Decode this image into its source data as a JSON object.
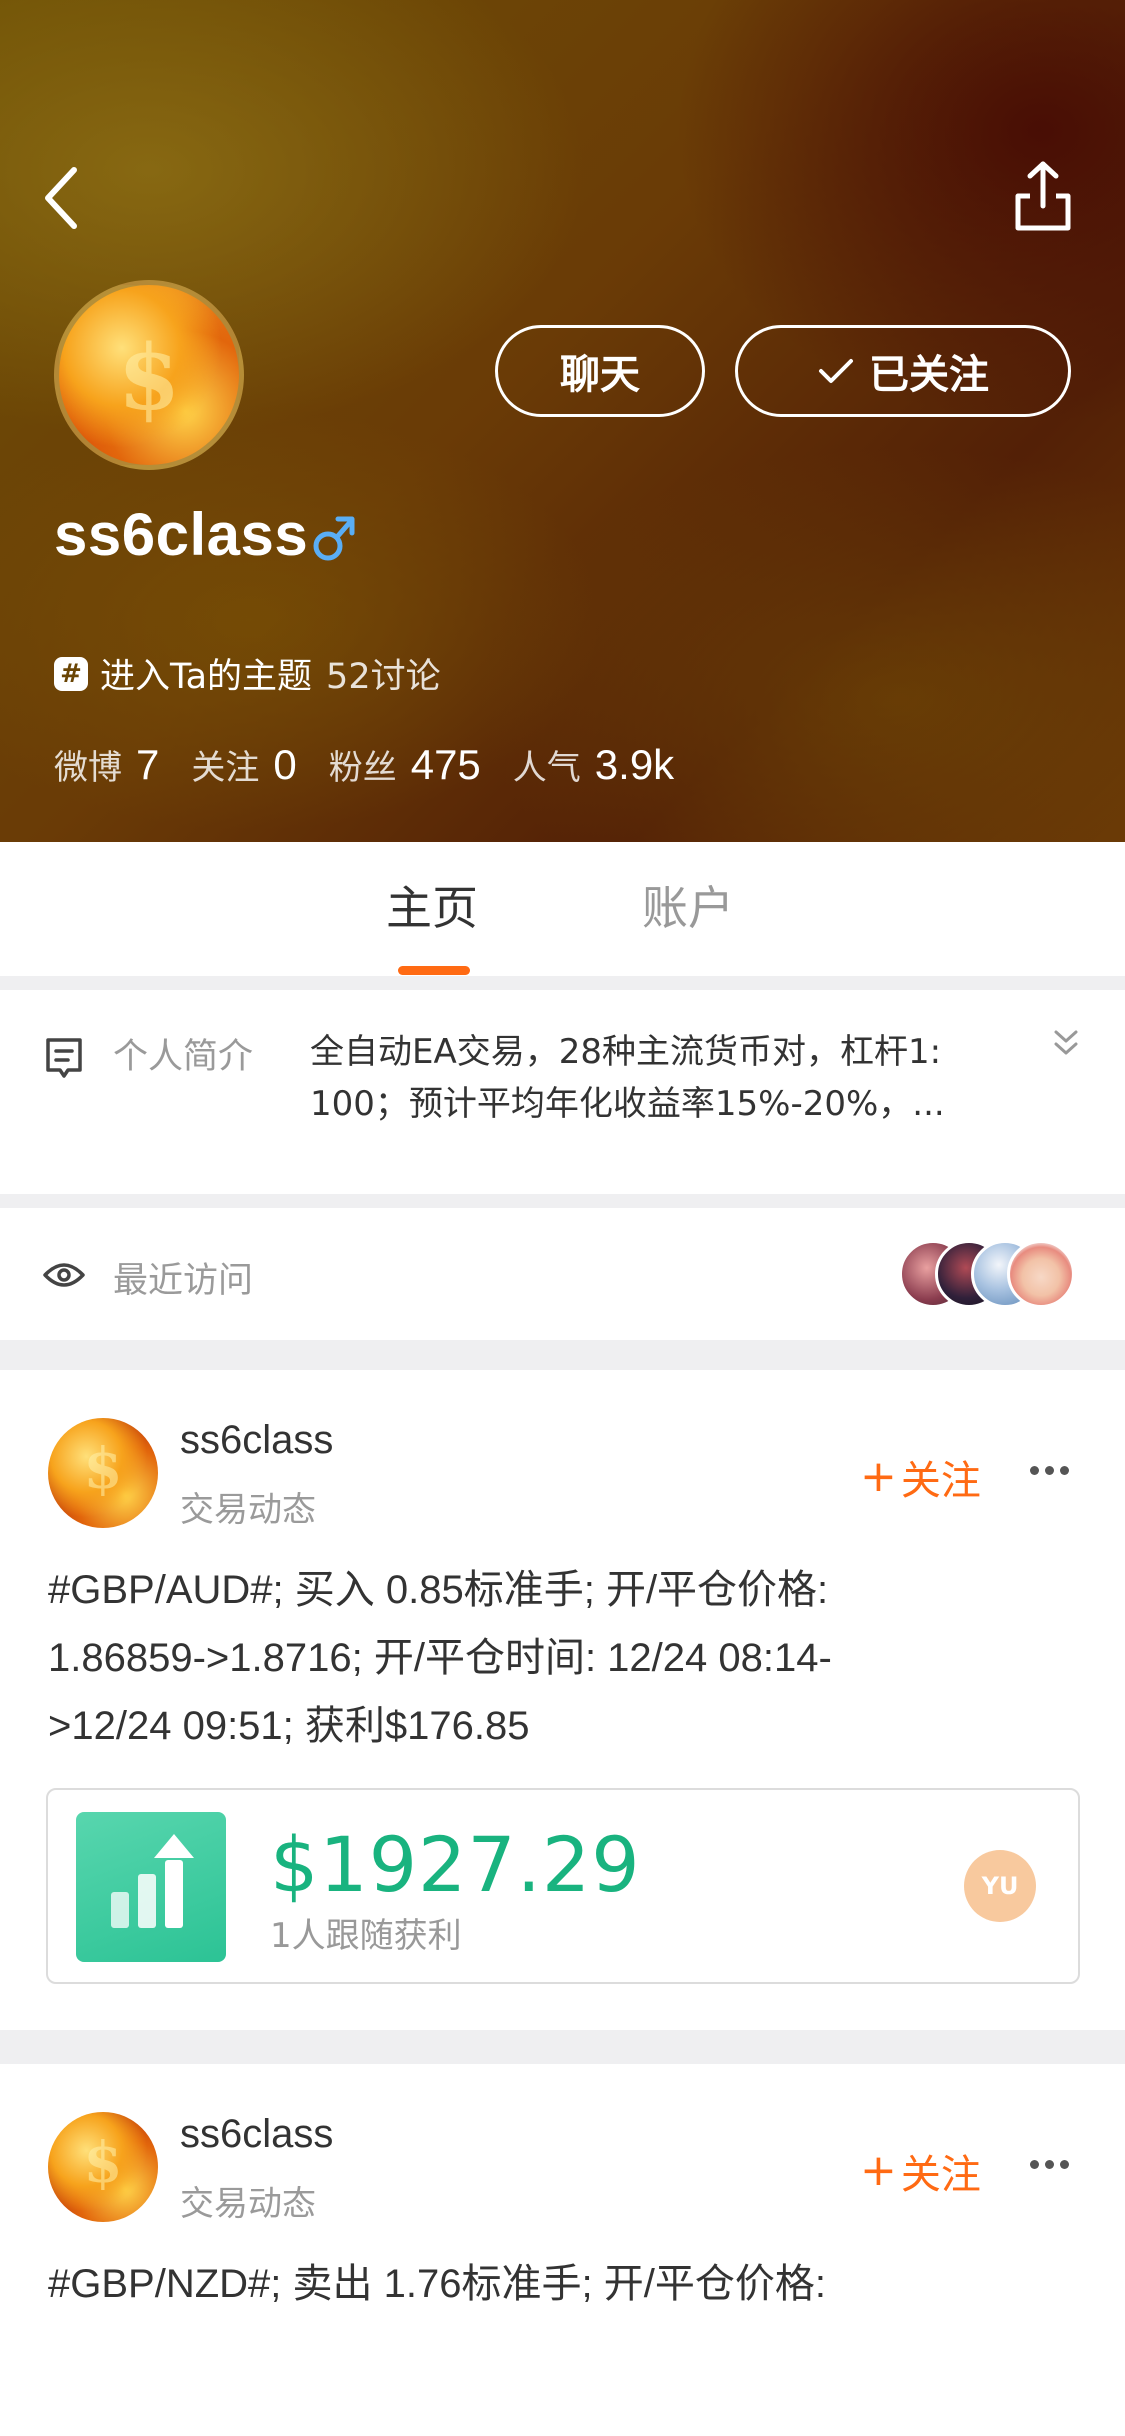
{
  "profile": {
    "username": "ss6class",
    "gender_icon": "male-symbol-icon",
    "chat_label": "聊天",
    "follow_label": "已关注",
    "topic_label": "进入Ta的主题",
    "topic_count": "52讨论",
    "stats": [
      {
        "label": "微博",
        "value": "7"
      },
      {
        "label": "关注",
        "value": "0"
      },
      {
        "label": "粉丝",
        "value": "475"
      },
      {
        "label": "人气",
        "value": "3.9k"
      }
    ]
  },
  "tabs": [
    {
      "label": "主页",
      "active": true
    },
    {
      "label": "账户",
      "active": false
    }
  ],
  "intro": {
    "label": "个人简介",
    "lines": [
      "全自动EA交易，28种主流货币对，杠杆1:",
      "100；预计平均年化收益率15%-20%，..."
    ]
  },
  "visits": {
    "label": "最近访问"
  },
  "posts": [
    {
      "name": "ss6class",
      "sub": "交易动态",
      "follow_label": "关注",
      "lines": [
        "#GBP/AUD#; 买入 0.85标准手; 开/平仓价格:",
        "1.86859->1.8716; 开/平仓时间: 12/24 08:14-",
        ">12/24 09:51; 获利$176.85"
      ],
      "profit_amount": "$1927.29",
      "profit_label": "1人跟随获利",
      "follower_initials": "YU"
    },
    {
      "name": "ss6class",
      "sub": "交易动态",
      "follow_label": "关注",
      "lines": [
        "#GBP/NZD#; 卖出 1.76标准手; 开/平仓价格:"
      ]
    }
  ],
  "colors": {
    "accent": "#ff6a13",
    "profit_green": "#19b37f",
    "header_bg": "#6a4406"
  }
}
